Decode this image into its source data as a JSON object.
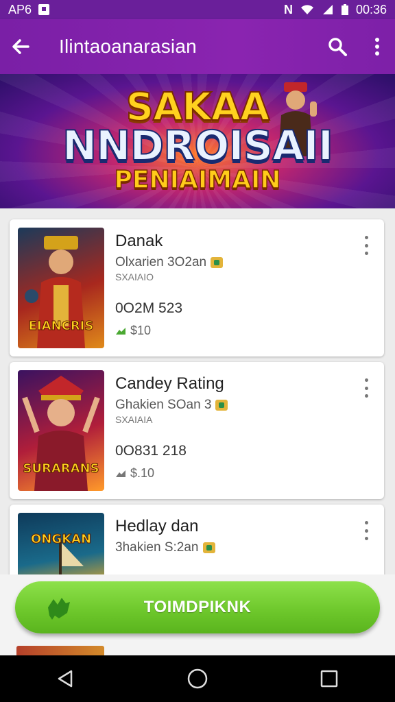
{
  "status_bar": {
    "left_text": "AP6",
    "time": "00:36"
  },
  "app_bar": {
    "title": "Ilintaoanarasian",
    "back_icon": "arrow-left-icon",
    "search_icon": "search-icon",
    "more_icon": "more-vert-icon"
  },
  "banner": {
    "line1": "SAKAA",
    "line2": "NNDROISAII",
    "line3": "PENIAIMAIN"
  },
  "items": [
    {
      "name": "Danak",
      "subtitle": "Olxarien 3O2an",
      "subtitle2": "SXAIAIO",
      "count": "0O2M 523",
      "price": "$10",
      "thumb_caption": "EIANCRIS",
      "thumb_colors": [
        "#1b3a5a",
        "#a8281e",
        "#e08a1a"
      ]
    },
    {
      "name": "Candey Rating",
      "subtitle": "Ghakien SOan 3",
      "subtitle2": "SXAIAIA",
      "count": "0O831 218",
      "price": "$.10",
      "thumb_caption": "SURARANS",
      "thumb_colors": [
        "#3a1260",
        "#b01e3a",
        "#ff9a2a"
      ]
    },
    {
      "name": "Hedlay dan",
      "subtitle": "3hakien S:2an",
      "subtitle2": "",
      "count": "",
      "price": "",
      "thumb_caption": "ONGKAN",
      "thumb_colors": [
        "#0e3a5a",
        "#1a6a8a",
        "#e0a82a"
      ]
    }
  ],
  "cta": {
    "label": "TOIMDPIKNK",
    "icon": "hand-icon",
    "color": "#6cc62a"
  },
  "colors": {
    "primary": "#7a1fa6",
    "accent_green": "#6cc62a"
  }
}
